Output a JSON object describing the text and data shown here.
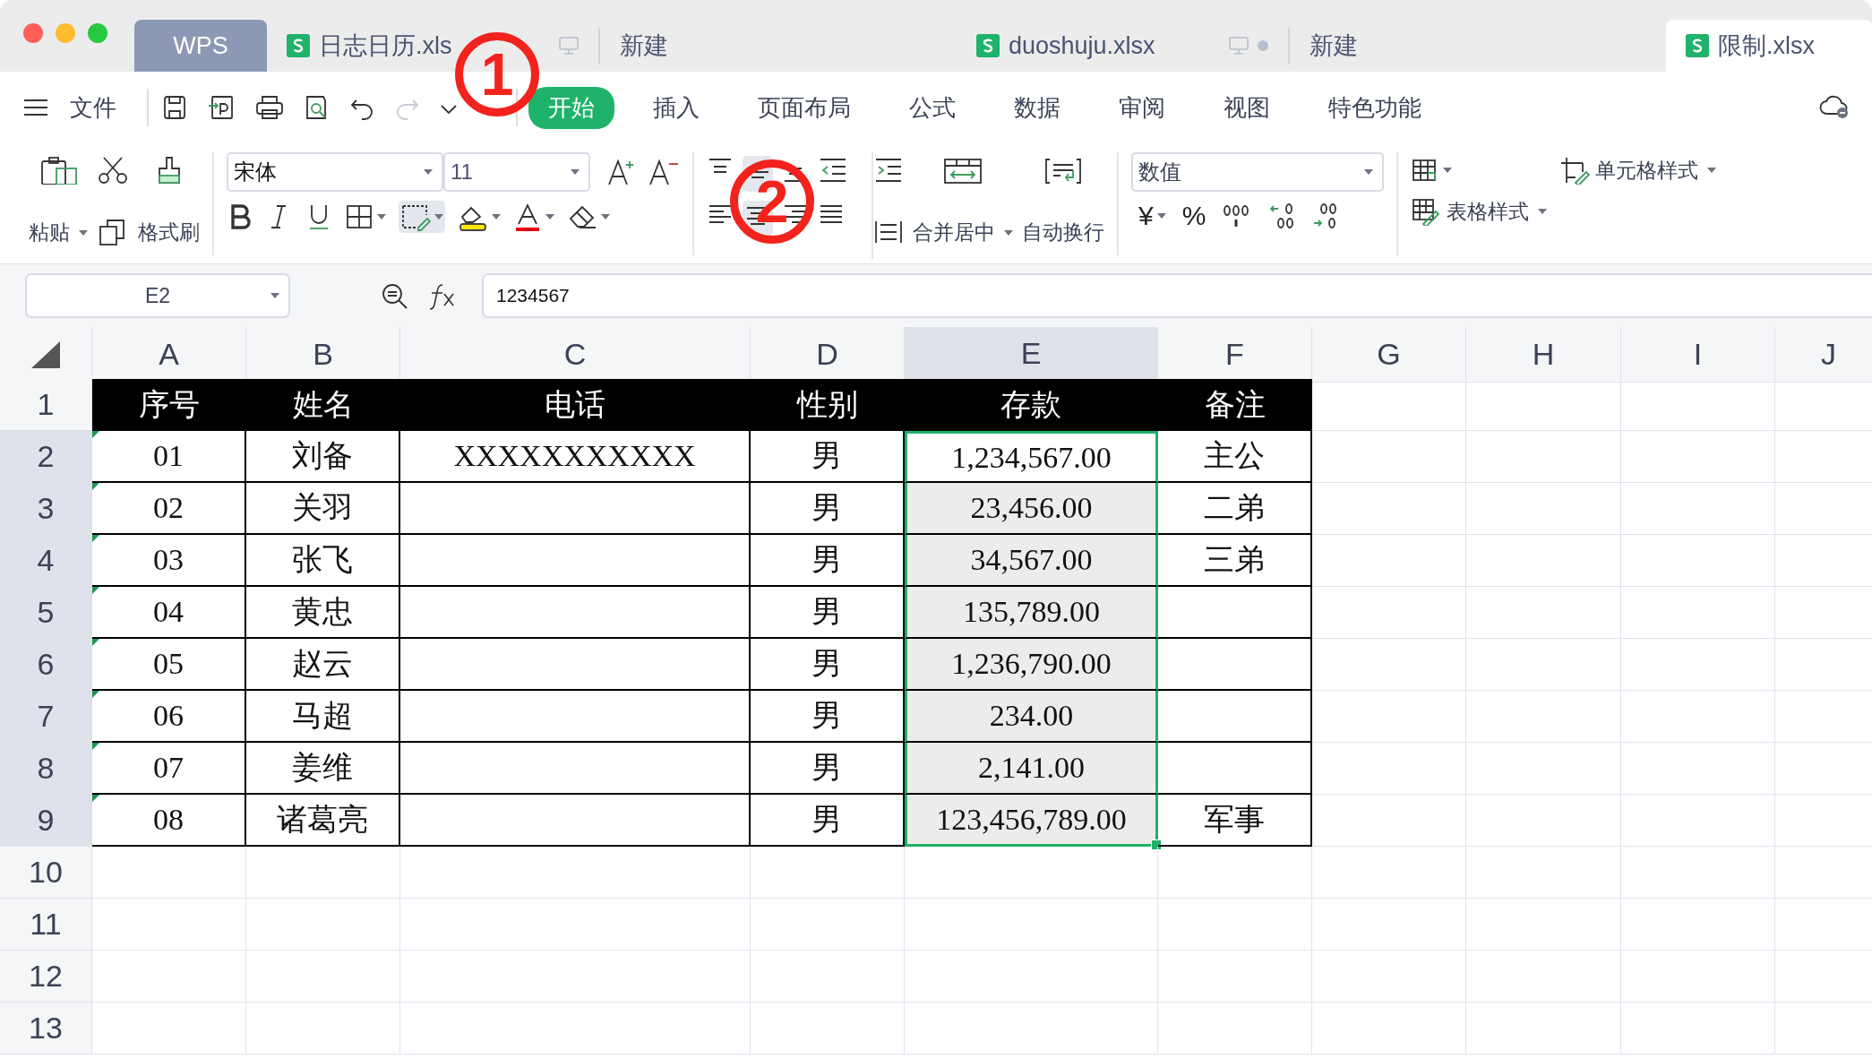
{
  "tabs": [
    {
      "label": "WPS",
      "kind": "home",
      "selected": false,
      "unsaved": false
    },
    {
      "label": "日志日历.xls",
      "kind": "file",
      "selected": false,
      "unsaved": false
    },
    {
      "label": "新建",
      "kind": "new",
      "selected": false,
      "unsaved": false
    },
    {
      "label": "duoshuju.xlsx",
      "kind": "file",
      "selected": false,
      "unsaved": true
    },
    {
      "label": "新建",
      "kind": "new",
      "selected": false,
      "unsaved": false
    },
    {
      "label": "限制.xlsx",
      "kind": "file",
      "selected": true,
      "unsaved": false
    }
  ],
  "menu": {
    "file_label": "文件",
    "items": [
      {
        "label": "开始",
        "selected": true
      },
      {
        "label": "插入",
        "selected": false
      },
      {
        "label": "页面布局",
        "selected": false
      },
      {
        "label": "公式",
        "selected": false
      },
      {
        "label": "数据",
        "selected": false
      },
      {
        "label": "审阅",
        "selected": false
      },
      {
        "label": "视图",
        "selected": false
      },
      {
        "label": "特色功能",
        "selected": false
      }
    ]
  },
  "ribbon": {
    "paste": "粘贴",
    "format_painter": "格式刷",
    "font": "宋体",
    "font_size": "11",
    "merge": "合并居中",
    "wrap": "自动换行",
    "number_format": "数值",
    "currency": "¥",
    "percent": "%",
    "cell_style": "单元格样式",
    "table_style": "表格样式"
  },
  "formula_bar": {
    "name_box": "E2",
    "formula": "1234567"
  },
  "columns": [
    {
      "label": "A",
      "selected": false
    },
    {
      "label": "B",
      "selected": false
    },
    {
      "label": "C",
      "selected": false
    },
    {
      "label": "D",
      "selected": false
    },
    {
      "label": "E",
      "selected": true
    },
    {
      "label": "F",
      "selected": false
    },
    {
      "label": "G",
      "selected": false
    },
    {
      "label": "H",
      "selected": false
    },
    {
      "label": "I",
      "selected": false
    },
    {
      "label": "J",
      "selected": false
    }
  ],
  "rows": [
    {
      "number": "1",
      "kind": "header",
      "selected": false,
      "flagged": false,
      "cells": [
        "序号",
        "姓名",
        "电话",
        "性别",
        "存款",
        "备注"
      ]
    },
    {
      "number": "2",
      "kind": "data",
      "selected": true,
      "flagged": true,
      "cells": [
        "01",
        "刘备",
        "XXXXXXXXXXX",
        "男",
        "1,234,567.00",
        "主公"
      ]
    },
    {
      "number": "3",
      "kind": "data",
      "selected": true,
      "flagged": true,
      "cells": [
        "02",
        "关羽",
        "",
        "男",
        "23,456.00",
        "二弟"
      ]
    },
    {
      "number": "4",
      "kind": "data",
      "selected": true,
      "flagged": true,
      "cells": [
        "03",
        "张飞",
        "",
        "男",
        "34,567.00",
        "三弟"
      ]
    },
    {
      "number": "5",
      "kind": "data",
      "selected": true,
      "flagged": true,
      "cells": [
        "04",
        "黄忠",
        "",
        "男",
        "135,789.00",
        ""
      ]
    },
    {
      "number": "6",
      "kind": "data",
      "selected": true,
      "flagged": true,
      "cells": [
        "05",
        "赵云",
        "",
        "男",
        "1,236,790.00",
        ""
      ]
    },
    {
      "number": "7",
      "kind": "data",
      "selected": true,
      "flagged": true,
      "cells": [
        "06",
        "马超",
        "",
        "男",
        "234.00",
        ""
      ]
    },
    {
      "number": "8",
      "kind": "data",
      "selected": true,
      "flagged": true,
      "cells": [
        "07",
        "姜维",
        "",
        "男",
        "2,141.00",
        ""
      ]
    },
    {
      "number": "9",
      "kind": "data",
      "selected": true,
      "flagged": true,
      "cells": [
        "08",
        "诸葛亮",
        "",
        "男",
        "123,456,789.00",
        "军事"
      ]
    },
    {
      "number": "10",
      "kind": "empty",
      "selected": false,
      "flagged": false,
      "cells": []
    },
    {
      "number": "11",
      "kind": "empty",
      "selected": false,
      "flagged": false,
      "cells": []
    },
    {
      "number": "12",
      "kind": "empty",
      "selected": false,
      "flagged": false,
      "cells": []
    },
    {
      "number": "13",
      "kind": "empty",
      "selected": false,
      "flagged": false,
      "cells": []
    }
  ],
  "callouts": [
    {
      "label": "1"
    },
    {
      "label": "2"
    }
  ]
}
